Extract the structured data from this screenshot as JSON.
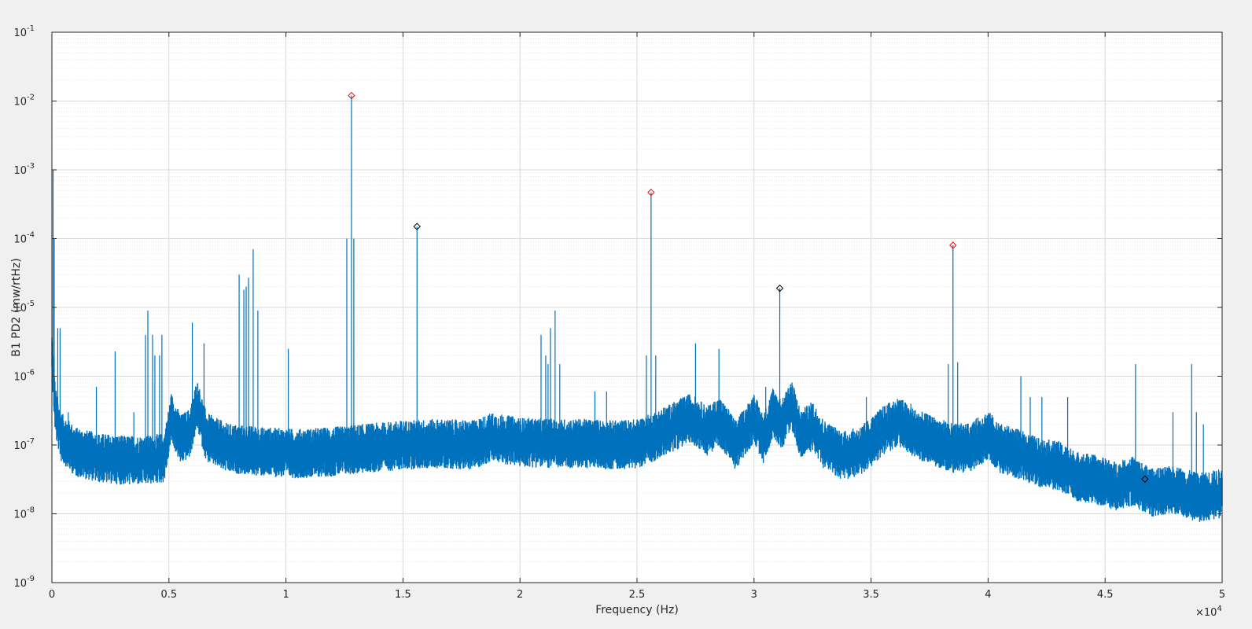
{
  "chart_data": {
    "type": "line",
    "title": "",
    "xlabel": "Frequency (Hz)",
    "ylabel": "B1 PD2 (mw/rtHz)",
    "x_multiplier_label": "×10",
    "x_multiplier_exp": "4",
    "xlim": [
      0,
      50000
    ],
    "ylim": [
      1e-09,
      0.1
    ],
    "yscale": "log",
    "grid": {
      "major": true,
      "minor_y": true
    },
    "colors": {
      "line": "#0072bd",
      "red_marker": "#ff0000",
      "black_marker": "#000000",
      "axes": "#262626",
      "grid": "#d9d9d9",
      "background": "#ffffff"
    },
    "x_ticks": [
      {
        "value": 0,
        "label": "0"
      },
      {
        "value": 5000,
        "label": "0.5"
      },
      {
        "value": 10000,
        "label": "1"
      },
      {
        "value": 15000,
        "label": "1.5"
      },
      {
        "value": 20000,
        "label": "2"
      },
      {
        "value": 25000,
        "label": "2.5"
      },
      {
        "value": 30000,
        "label": "3"
      },
      {
        "value": 35000,
        "label": "3.5"
      },
      {
        "value": 40000,
        "label": "4"
      },
      {
        "value": 45000,
        "label": "4.5"
      },
      {
        "value": 50000,
        "label": "5"
      }
    ],
    "y_ticks": [
      {
        "value": 0.1,
        "base": "10",
        "exp": "-1"
      },
      {
        "value": 0.01,
        "base": "10",
        "exp": "-2"
      },
      {
        "value": 0.001,
        "base": "10",
        "exp": "-3"
      },
      {
        "value": 0.0001,
        "base": "10",
        "exp": "-4"
      },
      {
        "value": 1e-05,
        "base": "10",
        "exp": "-5"
      },
      {
        "value": 1e-06,
        "base": "10",
        "exp": "-6"
      },
      {
        "value": 1e-07,
        "base": "10",
        "exp": "-7"
      },
      {
        "value": 1e-08,
        "base": "10",
        "exp": "-8"
      },
      {
        "value": 1e-09,
        "base": "10",
        "exp": "-9"
      }
    ],
    "baseline": [
      [
        0,
        2e-06
      ],
      [
        150,
        3e-07
      ],
      [
        400,
        1.3e-07
      ],
      [
        1000,
        8e-08
      ],
      [
        2000,
        6.5e-08
      ],
      [
        3000,
        6e-08
      ],
      [
        4000,
        6e-08
      ],
      [
        4800,
        6.5e-08
      ],
      [
        5100,
        2.5e-07
      ],
      [
        5500,
        1.2e-07
      ],
      [
        5900,
        1.5e-07
      ],
      [
        6200,
        4e-07
      ],
      [
        6600,
        1.3e-07
      ],
      [
        7500,
        9e-08
      ],
      [
        9000,
        8e-08
      ],
      [
        10500,
        7.5e-08
      ],
      [
        12000,
        8e-08
      ],
      [
        13500,
        9e-08
      ],
      [
        15000,
        1e-07
      ],
      [
        16500,
        1.05e-07
      ],
      [
        18000,
        1e-07
      ],
      [
        18800,
        1.3e-07
      ],
      [
        20000,
        1.1e-07
      ],
      [
        21500,
        1.05e-07
      ],
      [
        23000,
        1.05e-07
      ],
      [
        24000,
        1e-07
      ],
      [
        25000,
        1.05e-07
      ],
      [
        25700,
        1.3e-07
      ],
      [
        26500,
        1.8e-07
      ],
      [
        27300,
        2.5e-07
      ],
      [
        28000,
        1.6e-07
      ],
      [
        28500,
        2.2e-07
      ],
      [
        28900,
        1.5e-07
      ],
      [
        29200,
        1e-07
      ],
      [
        29600,
        1.5e-07
      ],
      [
        30000,
        2.5e-07
      ],
      [
        30400,
        1.2e-07
      ],
      [
        30800,
        3e-07
      ],
      [
        31200,
        2e-07
      ],
      [
        31600,
        4e-07
      ],
      [
        32000,
        1.4e-07
      ],
      [
        32500,
        1.9e-07
      ],
      [
        33000,
        1e-07
      ],
      [
        33800,
        7e-08
      ],
      [
        34500,
        8e-08
      ],
      [
        35000,
        1.1e-07
      ],
      [
        35500,
        1.6e-07
      ],
      [
        36200,
        2.2e-07
      ],
      [
        36800,
        1.5e-07
      ],
      [
        37500,
        1.2e-07
      ],
      [
        38500,
        9e-08
      ],
      [
        39200,
        9e-08
      ],
      [
        40000,
        1.4e-07
      ],
      [
        40500,
        9e-08
      ],
      [
        41500,
        7e-08
      ],
      [
        42200,
        5.5e-08
      ],
      [
        43000,
        5e-08
      ],
      [
        43800,
        3.5e-08
      ],
      [
        44500,
        3.2e-08
      ],
      [
        45500,
        2.5e-08
      ],
      [
        46200,
        3e-08
      ],
      [
        47000,
        2e-08
      ],
      [
        48000,
        2.2e-08
      ],
      [
        49000,
        1.7e-08
      ],
      [
        50000,
        2e-08
      ]
    ],
    "spikes": [
      [
        50,
        0.001
      ],
      [
        100,
        0.0001
      ],
      [
        250,
        5e-06
      ],
      [
        350,
        5e-06
      ],
      [
        700,
        3e-07
      ],
      [
        1900,
        7e-07
      ],
      [
        2700,
        2.3e-06
      ],
      [
        3500,
        3e-07
      ],
      [
        4000,
        4e-06
      ],
      [
        4100,
        9e-06
      ],
      [
        4300,
        4e-06
      ],
      [
        4400,
        2e-06
      ],
      [
        4600,
        2e-06
      ],
      [
        4700,
        4e-06
      ],
      [
        6000,
        6e-06
      ],
      [
        6500,
        3e-06
      ],
      [
        8000,
        3e-05
      ],
      [
        8200,
        1.8e-05
      ],
      [
        8300,
        2e-05
      ],
      [
        8400,
        2.7e-05
      ],
      [
        8600,
        7e-05
      ],
      [
        8800,
        9e-06
      ],
      [
        10100,
        2.5e-06
      ],
      [
        12600,
        0.0001
      ],
      [
        12800,
        0.012
      ],
      [
        12900,
        0.0001
      ],
      [
        15600,
        0.00015
      ],
      [
        20900,
        4e-06
      ],
      [
        21100,
        2e-06
      ],
      [
        21200,
        1.5e-06
      ],
      [
        21300,
        5e-06
      ],
      [
        21500,
        9e-06
      ],
      [
        21700,
        1.5e-06
      ],
      [
        23200,
        6e-07
      ],
      [
        23700,
        6e-07
      ],
      [
        25400,
        2e-06
      ],
      [
        25600,
        0.00047
      ],
      [
        25800,
        2e-06
      ],
      [
        27500,
        3e-06
      ],
      [
        28500,
        2.5e-06
      ],
      [
        30500,
        7e-07
      ],
      [
        31100,
        1.9e-05
      ],
      [
        34800,
        5e-07
      ],
      [
        36700,
        4e-07
      ],
      [
        38300,
        1.5e-06
      ],
      [
        38500,
        8e-05
      ],
      [
        38700,
        1.6e-06
      ],
      [
        41400,
        1e-06
      ],
      [
        41800,
        5e-07
      ],
      [
        42300,
        5e-07
      ],
      [
        43400,
        5e-07
      ],
      [
        46300,
        1.5e-06
      ],
      [
        47900,
        3e-07
      ],
      [
        48700,
        1.5e-06
      ],
      [
        48900,
        3e-07
      ],
      [
        49200,
        2e-07
      ]
    ],
    "markers": [
      {
        "x": 12800,
        "y": 0.012,
        "color": "red"
      },
      {
        "x": 25600,
        "y": 0.00047,
        "color": "red"
      },
      {
        "x": 38500,
        "y": 8e-05,
        "color": "red"
      },
      {
        "x": 15600,
        "y": 0.00015,
        "color": "black"
      },
      {
        "x": 31100,
        "y": 1.9e-05,
        "color": "black"
      },
      {
        "x": 46700,
        "y": 3.2e-08,
        "color": "black"
      }
    ]
  }
}
